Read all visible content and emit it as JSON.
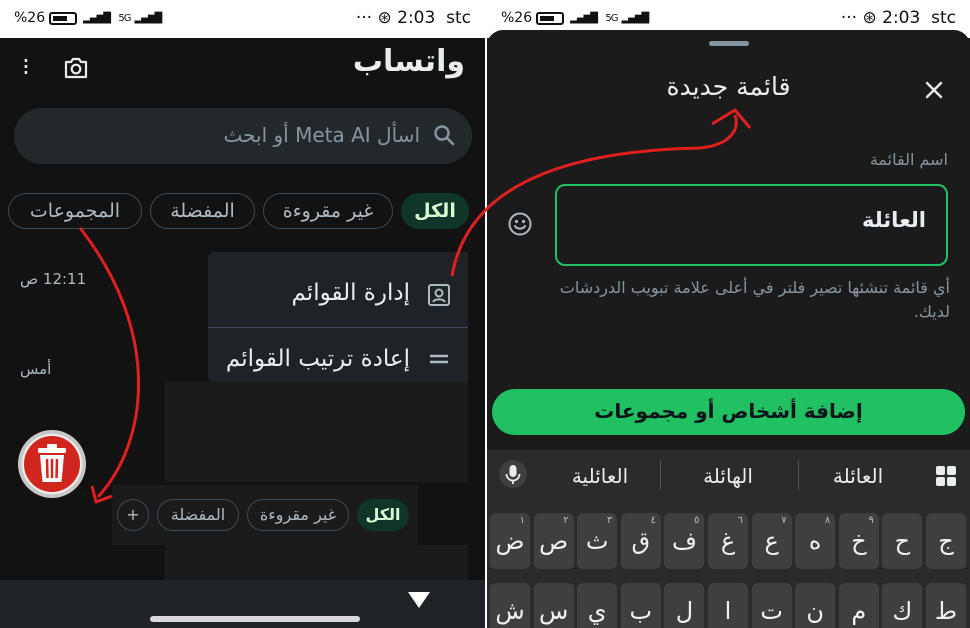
{
  "left_screen": {
    "status": {
      "left": "%26",
      "time": "2:03",
      "carrier": "stc",
      "net": "5G"
    },
    "app_title": "واتساب",
    "search_placeholder": "اسأل Meta AI أو ابحث",
    "chips": [
      "الكل",
      "غير مقروءة",
      "المفضلة",
      "المجموعات"
    ],
    "times": [
      "12:11 ص",
      "أمس"
    ],
    "popup_menu": [
      "إدارة القوائم",
      "إعادة ترتيب القوائم"
    ],
    "mini_chips": [
      "الكل",
      "غير مقروءة",
      "المفضلة"
    ],
    "mini_add": "+"
  },
  "right_screen": {
    "status": {
      "left": "%26",
      "time": "2:03",
      "carrier": "stc",
      "net": "5G"
    },
    "sheet_title": "قائمة جديدة",
    "field_label": "اسم القائمة",
    "field_value": "العائلة",
    "helper_text": "أي قائمة تنشئها تصير فلتر في أعلى علامة تبويب الدردشات لديك.",
    "cta_label": "إضافة أشخاص أو مجموعات",
    "suggestions": [
      "العائلة",
      "الهائلة",
      "العائلية"
    ],
    "keys_row1": [
      {
        "k": "ج",
        "s": ""
      },
      {
        "k": "ح",
        "s": ""
      },
      {
        "k": "خ",
        "s": "٩"
      },
      {
        "k": "ه",
        "s": "٨"
      },
      {
        "k": "ع",
        "s": "٧"
      },
      {
        "k": "غ",
        "s": "٦"
      },
      {
        "k": "ف",
        "s": "٥"
      },
      {
        "k": "ق",
        "s": "٤"
      },
      {
        "k": "ث",
        "s": "٣"
      },
      {
        "k": "ص",
        "s": "٢"
      },
      {
        "k": "ض",
        "s": "١"
      }
    ],
    "keys_row2": [
      "ط",
      "ك",
      "م",
      "ن",
      "ت",
      "ا",
      "ل",
      "ب",
      "ي",
      "س",
      "ش"
    ]
  },
  "colors": {
    "accent": "#21c063",
    "annotation": "#e0201f"
  }
}
